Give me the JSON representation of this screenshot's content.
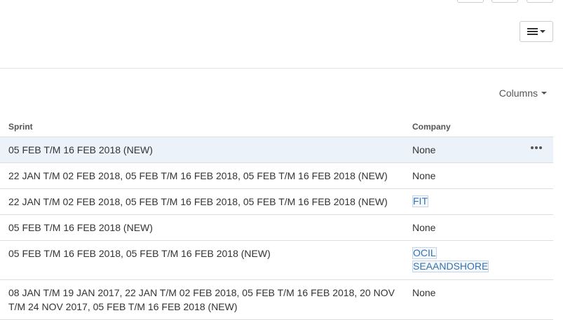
{
  "toolbar": {
    "menu_icon": "hamburger-menu-icon"
  },
  "columns_button": {
    "label": "Columns"
  },
  "table": {
    "headers": {
      "sprint": "Sprint",
      "company": "Company"
    },
    "rows": [
      {
        "sprint": "05 FEB T/M 16 FEB 2018 (NEW)",
        "company": "None",
        "tags": []
      },
      {
        "sprint": "22 JAN T/M 02 FEB 2018, 05 FEB T/M 16 FEB 2018, 05 FEB T/M 16 FEB 2018 (NEW)",
        "company": "None",
        "tags": []
      },
      {
        "sprint": "22 JAN T/M 02 FEB 2018, 05 FEB T/M 16 FEB 2018, 05 FEB T/M 16 FEB 2018 (NEW)",
        "company": "",
        "tags": [
          "FIT"
        ]
      },
      {
        "sprint": "05 FEB T/M 16 FEB 2018 (NEW)",
        "company": "None",
        "tags": []
      },
      {
        "sprint": "05 FEB T/M 16 FEB 2018, 05 FEB T/M 16 FEB 2018 (NEW)",
        "company": "",
        "tags": [
          "OCIL",
          "SEAANDSHORE"
        ]
      },
      {
        "sprint": "08 JAN T/M 19 JAN 2017, 22 JAN T/M 02 FEB 2018, 05 FEB T/M 16 FEB 2018, 20 NOV T/M 24 NOV 2017, 05 FEB T/M 16 FEB 2018 (NEW)",
        "company": "None",
        "tags": []
      }
    ]
  },
  "colors": {
    "row_highlight": "#ebf2fa",
    "tag_text": "#3572b0",
    "border": "#dddddd"
  }
}
